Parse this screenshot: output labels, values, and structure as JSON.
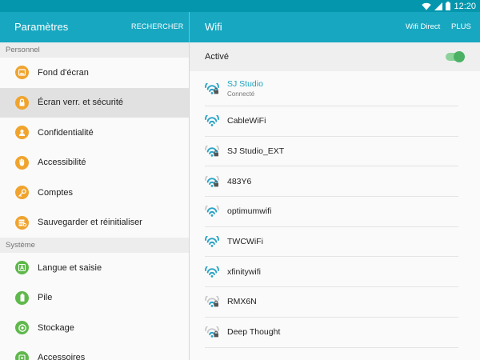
{
  "status_bar": {
    "time": "12:20",
    "icons": [
      "wifi-icon",
      "signal-icon",
      "battery-icon"
    ]
  },
  "header": {
    "left_title": "Paramètres",
    "search_label": "RECHERCHER",
    "right_title": "Wifi",
    "wifi_direct_label": "Wifi Direct",
    "more_label": "PLUS"
  },
  "sidebar": {
    "sections": [
      {
        "title": "Personnel",
        "items": [
          {
            "label": "Fond d'écran",
            "icon": "image-icon",
            "color": "#f0a42e"
          },
          {
            "label": "Écran verr. et sécurité",
            "icon": "lock-icon",
            "color": "#f0a42e",
            "selected": true
          },
          {
            "label": "Confidentialité",
            "icon": "privacy-icon",
            "color": "#f0a42e"
          },
          {
            "label": "Accessibilité",
            "icon": "hand-icon",
            "color": "#f0a42e"
          },
          {
            "label": "Comptes",
            "icon": "key-icon",
            "color": "#f0a42e"
          },
          {
            "label": "Sauvegarder et réinitialiser",
            "icon": "backup-icon",
            "color": "#f0a42e"
          }
        ]
      },
      {
        "title": "Système",
        "items": [
          {
            "label": "Langue et saisie",
            "icon": "language-icon",
            "color": "#5fb84b"
          },
          {
            "label": "Pile",
            "icon": "battery-icon",
            "color": "#5fb84b"
          },
          {
            "label": "Stockage",
            "icon": "storage-icon",
            "color": "#5fb84b"
          },
          {
            "label": "Accessoires",
            "icon": "accessories-icon",
            "color": "#5fb84b"
          }
        ]
      }
    ]
  },
  "wifi": {
    "active_label": "Activé",
    "enabled": true,
    "networks": [
      {
        "name": "SJ Studio",
        "status": "Connecté",
        "secured": true,
        "connected": true,
        "strength": "full"
      },
      {
        "name": "CableWiFi",
        "status": "",
        "secured": false,
        "connected": false,
        "strength": "full"
      },
      {
        "name": "SJ Studio_EXT",
        "status": "",
        "secured": true,
        "connected": false,
        "strength": "medium"
      },
      {
        "name": "483Y6",
        "status": "",
        "secured": true,
        "connected": false,
        "strength": "medium"
      },
      {
        "name": "optimumwifi",
        "status": "",
        "secured": false,
        "connected": false,
        "strength": "medium"
      },
      {
        "name": "TWCWiFi",
        "status": "",
        "secured": false,
        "connected": false,
        "strength": "full"
      },
      {
        "name": "xfinitywifi",
        "status": "",
        "secured": false,
        "connected": false,
        "strength": "full"
      },
      {
        "name": "RMX6N",
        "status": "",
        "secured": true,
        "connected": false,
        "strength": "weak"
      },
      {
        "name": "Deep Thought",
        "status": "",
        "secured": true,
        "connected": false,
        "strength": "weak"
      }
    ]
  },
  "colors": {
    "status_bar": "#0396ad",
    "app_bar": "#17a7c1",
    "accent": "#1da4c0",
    "wifi_icon": "#29a3c6",
    "toggle_on": "#4cb164"
  }
}
